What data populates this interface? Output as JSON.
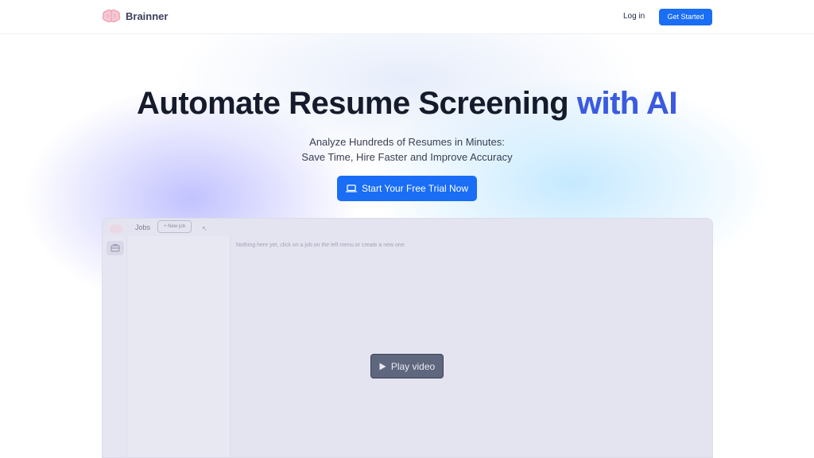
{
  "header": {
    "brand": "Brainner",
    "login_label": "Log in",
    "get_started_label": "Get Started"
  },
  "hero": {
    "title_main": "Automate Resume Screening",
    "title_accent": "with AI",
    "subtitle_line1": "Analyze Hundreds of Resumes in Minutes:",
    "subtitle_line2": "Save Time, Hire Faster and Improve Accuracy",
    "cta_label": "Start Your Free Trial Now",
    "cta_icon": "laptop-icon"
  },
  "app_preview": {
    "jobs_label": "Jobs",
    "new_job_label": "+ New job",
    "empty_message": "Nothing here yet, click on a job on the left menu or create a new one.",
    "sidebar_icon": "briefcase-icon"
  },
  "video": {
    "play_label": "Play video",
    "play_icon": "play-icon"
  },
  "colors": {
    "accent": "#1a6df5",
    "title": "#161b2c",
    "accent_text": "#3b5ae0"
  }
}
